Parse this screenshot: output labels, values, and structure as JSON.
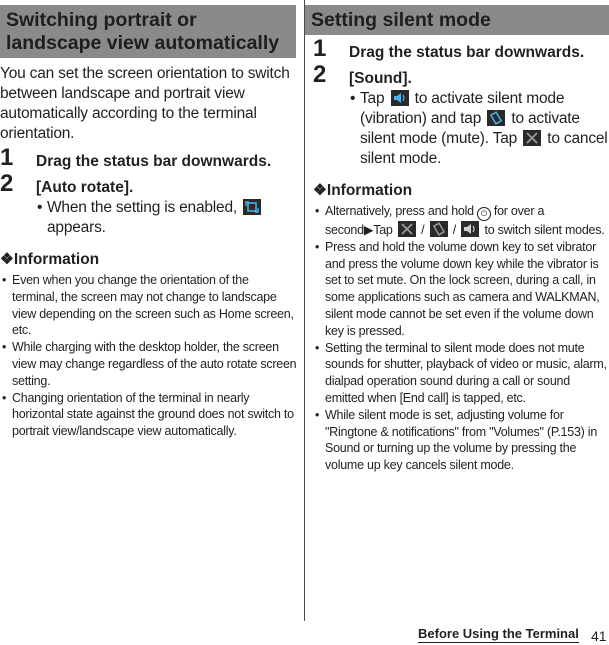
{
  "left": {
    "title": "Switching portrait or landscape view automatically",
    "intro": "You can set the screen orientation to switch between landscape and portrait view automatically according to the terminal orientation.",
    "steps": [
      {
        "num": "1",
        "text": "Drag the status bar downwards."
      },
      {
        "num": "2",
        "text": "[Auto rotate]."
      }
    ],
    "note_before": "When the setting is enabled,",
    "note_after": "appears.",
    "note_icon": "auto-rotate-icon",
    "info_title": "❖Information",
    "info": [
      "Even when you change the orientation of the terminal, the screen may not change to landscape view depending on the screen such as Home screen, etc.",
      "While charging with the desktop holder, the screen view may change regardless of the auto rotate screen setting.",
      "Changing orientation of the terminal in nearly horizontal state against the ground does not switch to portrait view/landscape view automatically."
    ]
  },
  "right": {
    "title": "Setting silent mode",
    "steps": [
      {
        "num": "1",
        "text": "Drag the status bar downwards."
      },
      {
        "num": "2",
        "text": "[Sound]."
      }
    ],
    "note": {
      "p1": "Tap",
      "p2": "to activate silent mode (vibration) and tap",
      "p3": "to activate silent mode (mute). Tap",
      "p4": "to cancel silent mode."
    },
    "icons": {
      "sound": "sound-on-icon",
      "vibrate": "vibrate-icon",
      "mute": "mute-icon",
      "power": "power-key-icon"
    },
    "info_title": "❖Information",
    "info_first": {
      "a": "Alternatively, press and hold",
      "power_glyph": "⏻",
      "b": "for over a second",
      "arrow": "▶",
      "c": "Tap",
      "sep": "/",
      "d": "to switch silent modes."
    },
    "info": [
      "Press and hold the volume down key to set vibrator and press the volume down key while the vibrator is set to set mute. On the lock screen, during a call, in some applications such as camera and WALKMAN, silent mode cannot be set even if the volume down key is pressed.",
      "Setting the terminal to silent mode does not mute sounds for shutter, playback of video or music, alarm, dialpad operation sound during a call or sound emitted when [End call] is tapped, etc.",
      "While silent mode is set, adjusting volume for \"Ringtone & notifications\" from \"Volumes\" (P.153) in Sound or turning up the volume by pressing the volume up key cancels silent mode."
    ]
  },
  "footer": {
    "section": "Before Using the Terminal",
    "page": "41"
  },
  "bullet": "•"
}
